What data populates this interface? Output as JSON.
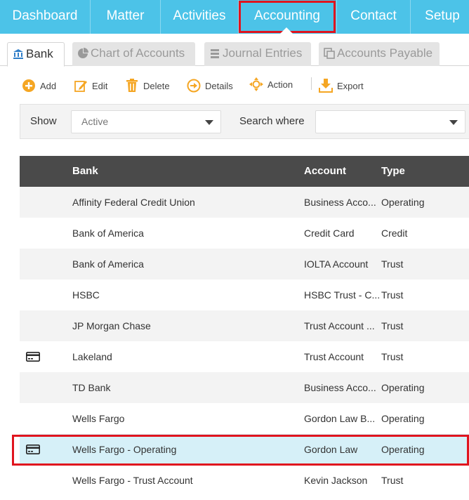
{
  "topnav": {
    "items": [
      "Dashboard",
      "Matter",
      "Activities",
      "Accounting",
      "Contact",
      "Setup"
    ],
    "active": "Accounting"
  },
  "tabs": [
    {
      "label": "Bank",
      "icon": "bank-icon",
      "active": true
    },
    {
      "label": "Chart of Accounts",
      "icon": "pie-chart-icon",
      "active": false
    },
    {
      "label": "Journal Entries",
      "icon": "ledger-icon",
      "active": false
    },
    {
      "label": "Accounts Payable",
      "icon": "copy-icon",
      "active": false
    }
  ],
  "toolbar": {
    "add": "Add",
    "edit": "Edit",
    "delete": "Delete",
    "details": "Details",
    "action": "Action",
    "export": "Export"
  },
  "filter": {
    "show_label": "Show",
    "show_value": "Active",
    "search_label": "Search where",
    "search_value": ""
  },
  "table": {
    "columns": [
      "Bank",
      "Account",
      "Type"
    ],
    "rows": [
      {
        "bank": "Affinity Federal Credit Union",
        "account": "Business Acco...",
        "type": "Operating",
        "card": false
      },
      {
        "bank": "Bank of America",
        "account": "Credit Card",
        "type": "Credit",
        "card": false
      },
      {
        "bank": "Bank of America",
        "account": "IOLTA Account",
        "type": "Trust",
        "card": false
      },
      {
        "bank": "HSBC",
        "account": "HSBC Trust - C...",
        "type": "Trust",
        "card": false
      },
      {
        "bank": "JP Morgan Chase",
        "account": "Trust Account ...",
        "type": "Trust",
        "card": false
      },
      {
        "bank": "Lakeland",
        "account": "Trust Account",
        "type": "Trust",
        "card": true
      },
      {
        "bank": "TD Bank",
        "account": "Business Acco...",
        "type": "Operating",
        "card": false
      },
      {
        "bank": "Wells Fargo",
        "account": "Gordon Law B...",
        "type": "Operating",
        "card": false
      },
      {
        "bank": "Wells Fargo - Operating",
        "account": "Gordon Law",
        "type": "Operating",
        "card": true,
        "selected": true
      },
      {
        "bank": "Wells Fargo - Trust Account",
        "account": "Kevin Jackson",
        "type": "Trust",
        "card": false
      }
    ]
  },
  "colors": {
    "nav_bg": "#4cc3e8",
    "header_bg": "#4a4a4a",
    "accent_orange": "#f5a623",
    "highlight": "#e0141e",
    "selected_row": "#d6f0f8"
  }
}
